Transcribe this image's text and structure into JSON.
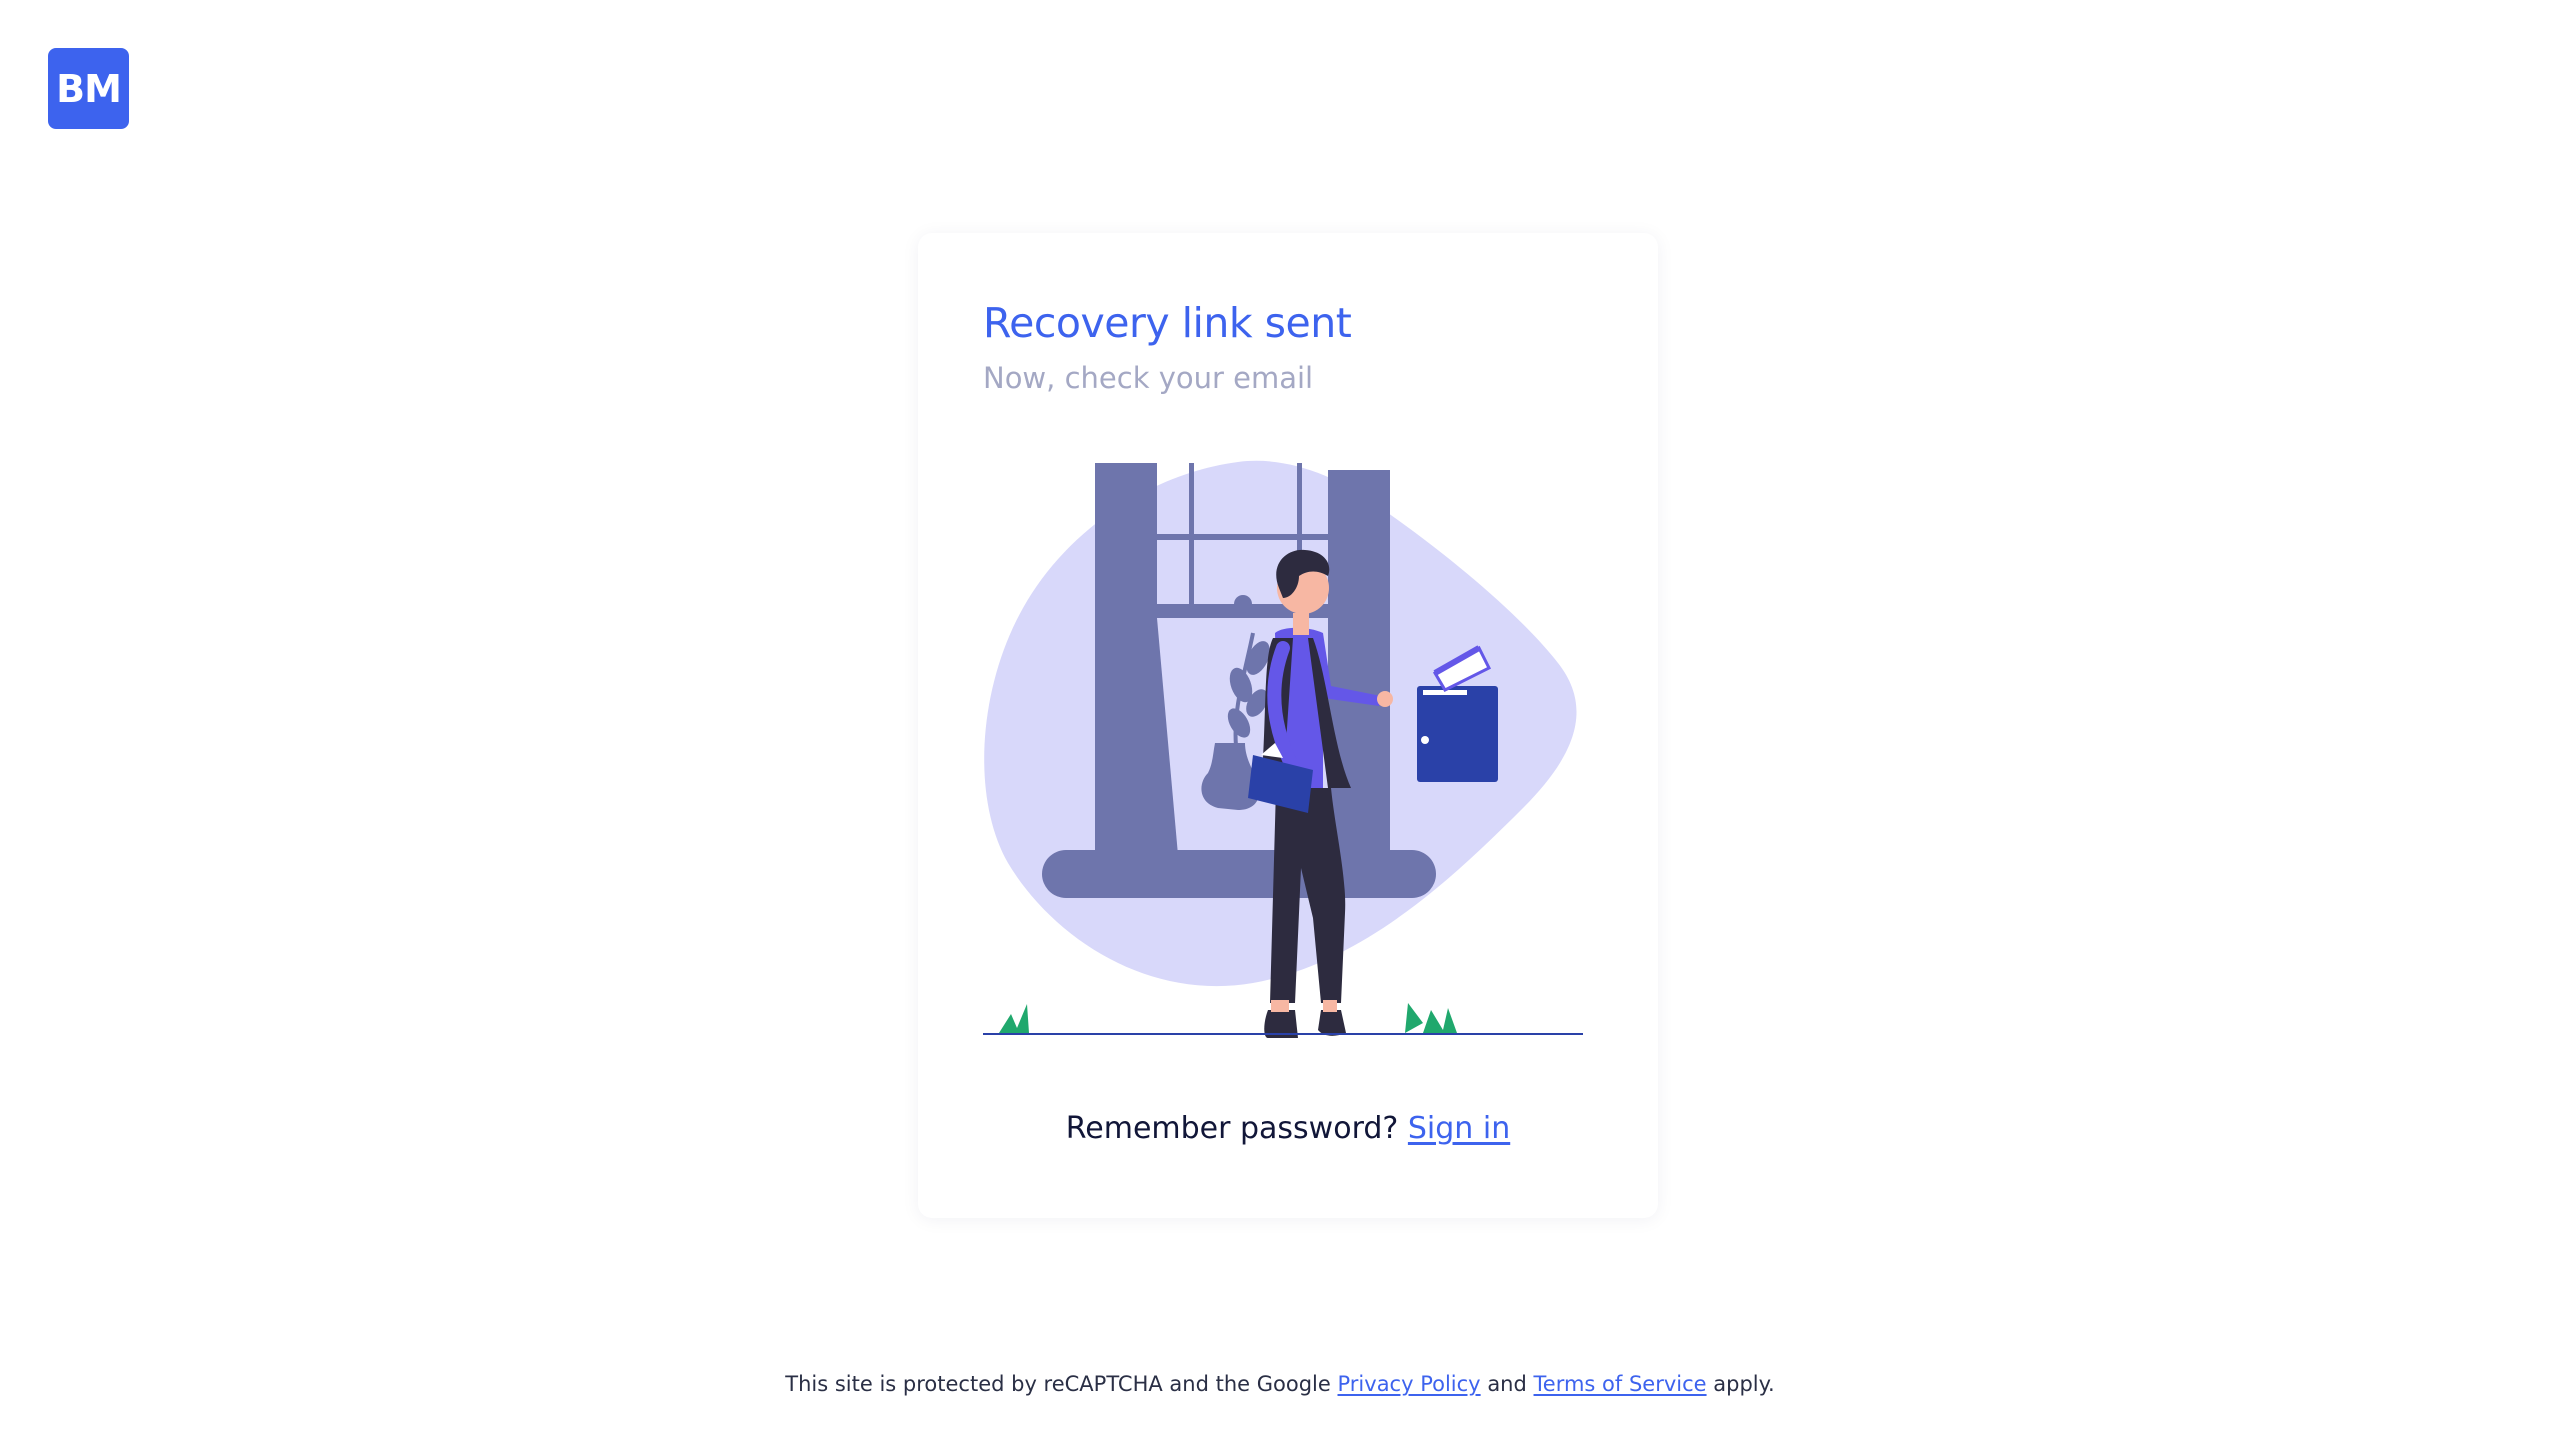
{
  "brand": {
    "logo_text": "BM",
    "accent_color": "#3d63ee"
  },
  "card": {
    "title": "Recovery link sent",
    "subtitle": "Now, check your email",
    "illustration_icon": "mailbox-person-illustration",
    "remember_text": "Remember password?",
    "signin_link": "Sign in"
  },
  "footer": {
    "prefix": "This site is protected by reCAPTCHA and the Google",
    "privacy_link": "Privacy Policy",
    "and_text": "and",
    "terms_link": "Terms of Service",
    "suffix": "apply."
  }
}
